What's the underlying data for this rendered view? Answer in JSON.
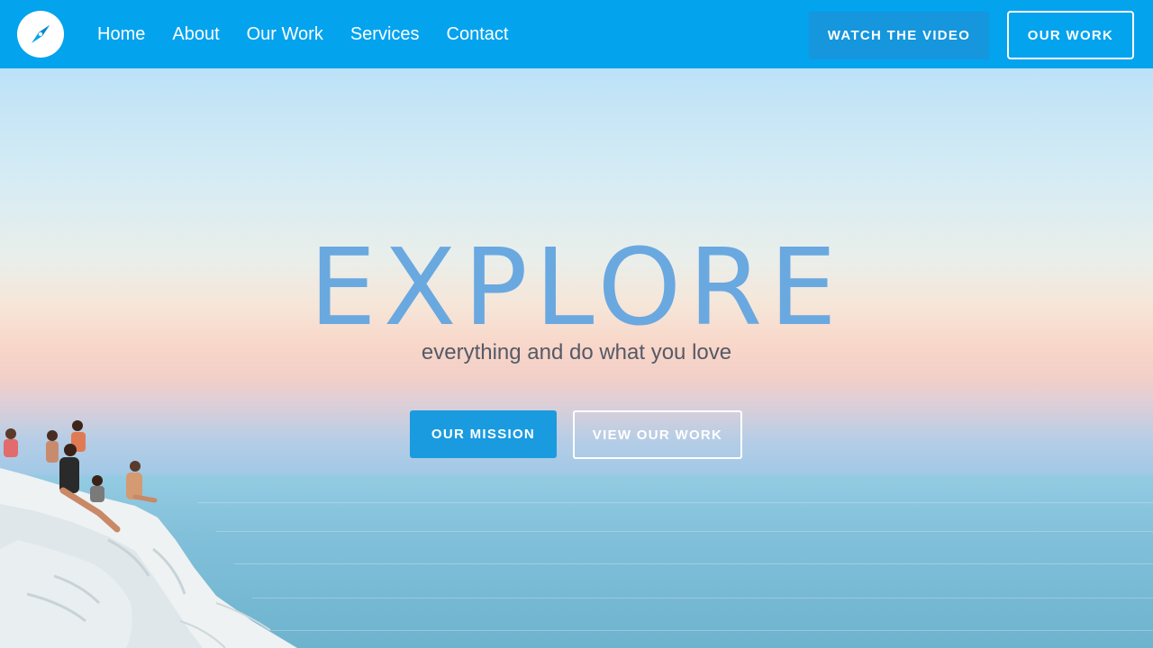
{
  "nav": {
    "links": [
      "Home",
      "About",
      "Our Work",
      "Services",
      "Contact"
    ],
    "watch_video_label": "WATCH THE VIDEO",
    "our_work_label": "OUR WORK",
    "logo_icon": "compass-icon"
  },
  "hero": {
    "title": "EXPLORE",
    "subtitle": "everything and do what you love",
    "mission_label": "OUR MISSION",
    "view_work_label": "VIEW OUR WORK"
  },
  "colors": {
    "nav_bg": "#03a3ee",
    "watch_video_bg": "#1596dd",
    "mission_bg": "#1a9be0",
    "title": "#6aa8e0",
    "subtitle": "#555a66"
  }
}
